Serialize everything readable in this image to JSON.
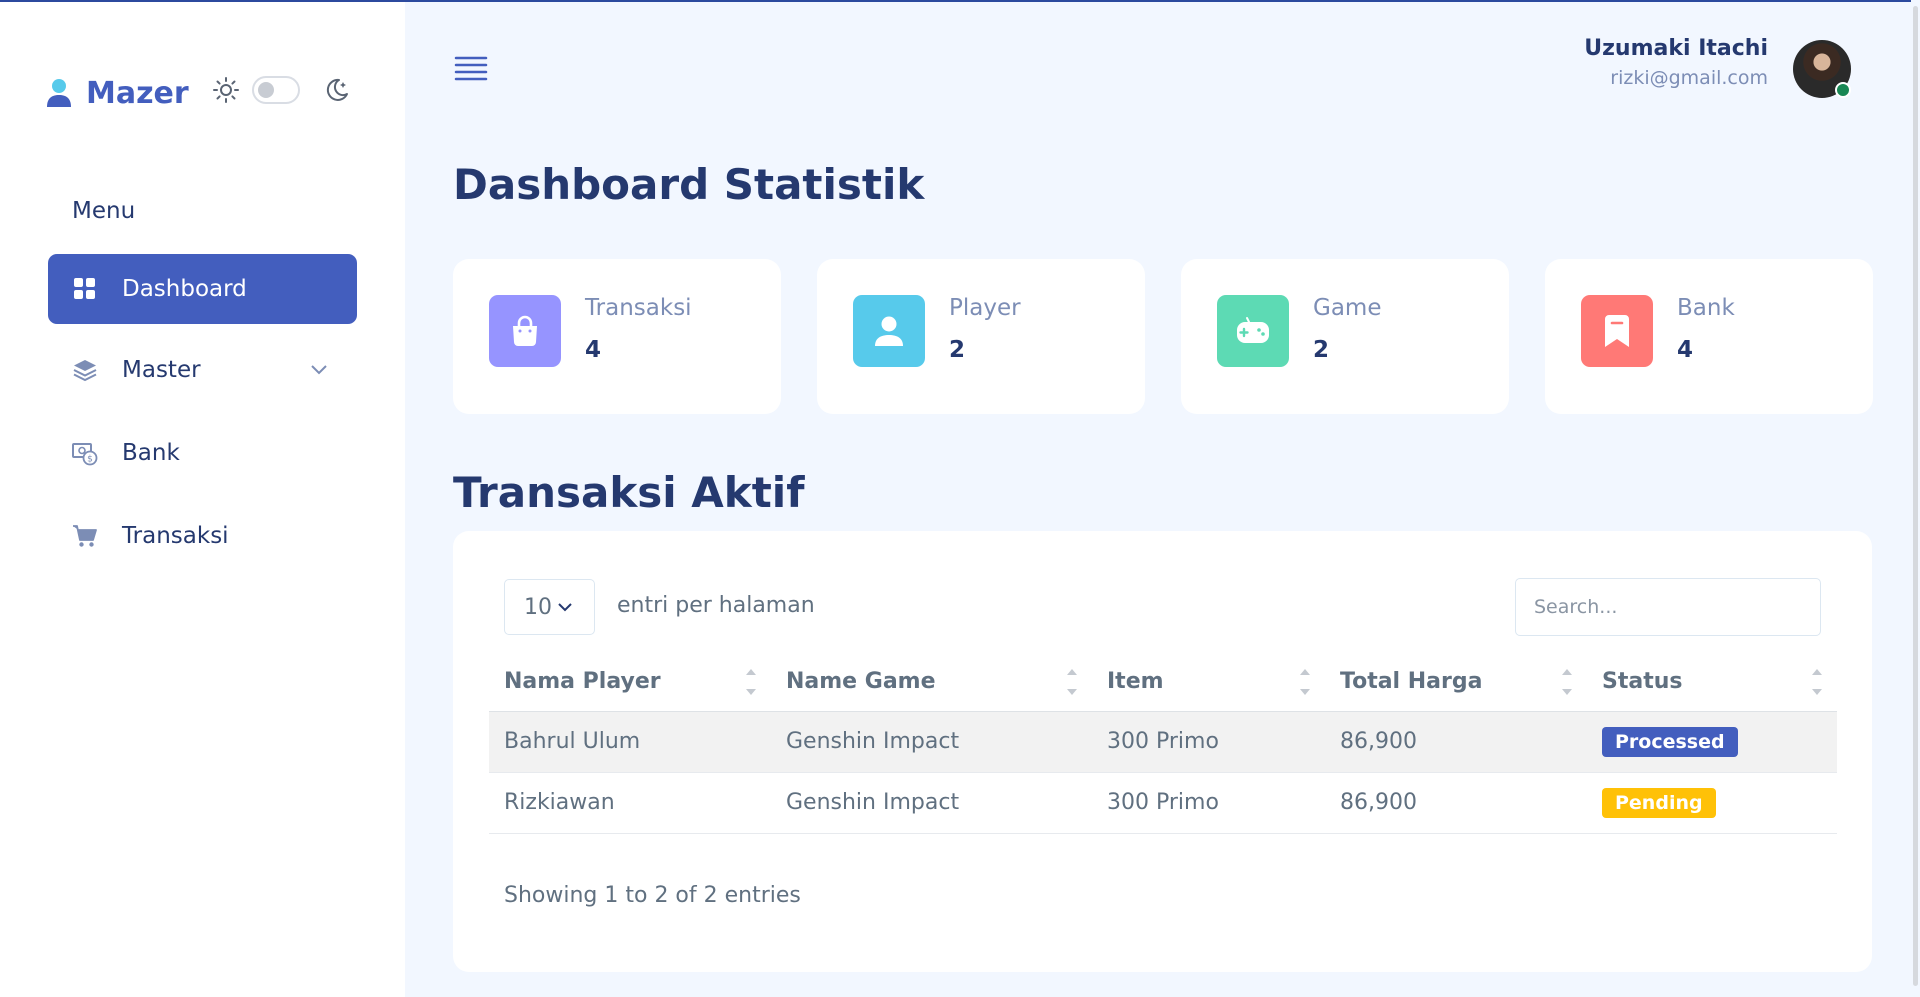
{
  "brand": {
    "name": "Mazer"
  },
  "sidebar": {
    "menu_title": "Menu",
    "items": [
      {
        "label": "Dashboard",
        "icon": "grid-icon",
        "active": true
      },
      {
        "label": "Master",
        "icon": "stack-icon",
        "has_submenu": true
      },
      {
        "label": "Bank",
        "icon": "cash-icon"
      },
      {
        "label": "Transaksi",
        "icon": "cart-icon"
      }
    ]
  },
  "user": {
    "name": "Uzumaki Itachi",
    "email": "rizki@gmail.com",
    "status_color": "#198754"
  },
  "page": {
    "title": "Dashboard Statistik"
  },
  "stats": [
    {
      "label": "Transaksi",
      "value": "4",
      "icon": "bag-icon",
      "color": "#9694ff"
    },
    {
      "label": "Player",
      "value": "2",
      "icon": "person-icon",
      "color": "#57caeb"
    },
    {
      "label": "Game",
      "value": "2",
      "icon": "controller-icon",
      "color": "#5ddab4"
    },
    {
      "label": "Bank",
      "value": "4",
      "icon": "bookmark-icon",
      "color": "#ff7976"
    }
  ],
  "transactions": {
    "title": "Transaksi Aktif",
    "page_length": "10",
    "length_label": "entri per halaman",
    "search_placeholder": "Search...",
    "columns": [
      "Nama Player",
      "Name Game",
      "Item",
      "Total Harga",
      "Status"
    ],
    "rows": [
      {
        "player": "Bahrul Ulum",
        "game": "Genshin Impact",
        "item": "300 Primo",
        "total": "86,900",
        "status": "Processed",
        "status_color": "#435ebe"
      },
      {
        "player": "Rizkiawan",
        "game": "Genshin Impact",
        "item": "300 Primo",
        "total": "86,900",
        "status": "Pending",
        "status_color": "#ffc107"
      }
    ],
    "info": "Showing 1 to 2 of 2 entries"
  },
  "colors": {
    "primary": "#435ebe",
    "background": "#f2f7ff",
    "heading": "#25396f"
  }
}
